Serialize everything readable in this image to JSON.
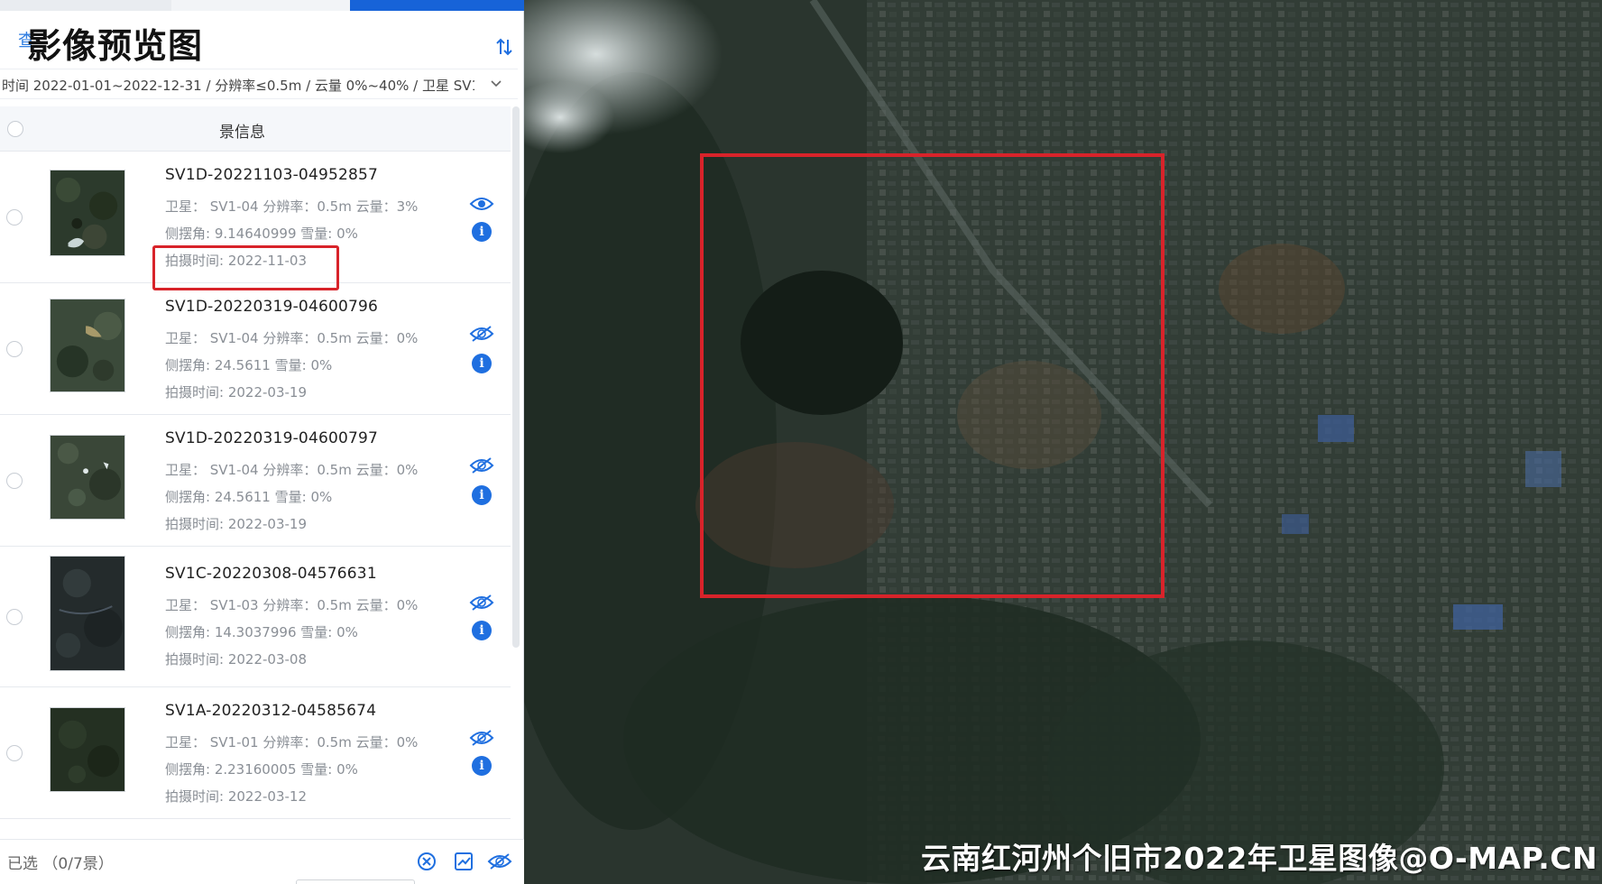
{
  "overlay_title": "影像预览图",
  "header": {
    "query_label": "查"
  },
  "filter": {
    "summary": "时间 2022-01-01~2022-12-31 / 分辨率≤0.5m / 云量 0%~40% / 卫星 SV1-0…"
  },
  "list": {
    "header_title": "景信息",
    "scenes": [
      {
        "id": "SV1D-20221103-04952857",
        "line1": "卫星： SV1-04  分辨率：0.5m  云量：3%",
        "line2": "侧摆角: 9.14640999   雪量: 0%",
        "time": "拍摄时间: 2022-11-03",
        "visible": true
      },
      {
        "id": "SV1D-20220319-04600796",
        "line1": "卫星： SV1-04  分辨率：0.5m  云量：0%",
        "line2": "侧摆角: 24.5611   雪量: 0%",
        "time": "拍摄时间: 2022-03-19",
        "visible": false
      },
      {
        "id": "SV1D-20220319-04600797",
        "line1": "卫星： SV1-04  分辨率：0.5m  云量：0%",
        "line2": "侧摆角: 24.5611   雪量: 0%",
        "time": "拍摄时间: 2022-03-19",
        "visible": false
      },
      {
        "id": "SV1C-20220308-04576631",
        "line1": "卫星： SV1-03  分辨率：0.5m  云量：0%",
        "line2": "侧摆角: 14.3037996   雪量: 0%",
        "time": "拍摄时间: 2022-03-08",
        "visible": false
      },
      {
        "id": "SV1A-20220312-04585674",
        "line1": "卫星： SV1-01  分辨率：0.5m  云量：0%",
        "line2": "侧摆角: 2.23160005   雪量: 0%",
        "time": "拍摄时间: 2022-03-12",
        "visible": false
      }
    ]
  },
  "footer": {
    "selected_label": "已选 （0/7景）"
  },
  "map": {
    "watermark": "云南红河州个旧市2022年卫星图像@O-MAP.CN"
  },
  "colors": {
    "accent": "#1f6fe0",
    "highlight": "#d8232a"
  }
}
